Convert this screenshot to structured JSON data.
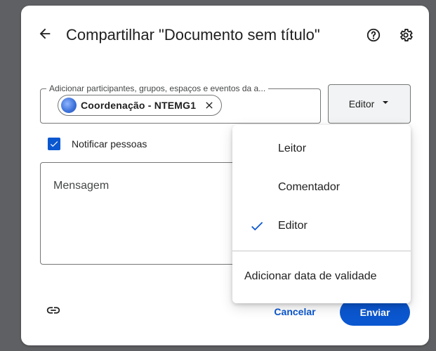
{
  "dialog": {
    "title": "Compartilhar \"Documento sem título\"",
    "share_field_label": "Adicionar participantes, grupos, espaços e eventos da a...",
    "chip_label": "Coordenação - NTEMG1",
    "role_selected": "Editor",
    "notify_label": "Notificar pessoas",
    "notify_checked": true,
    "message_placeholder": "Mensagem",
    "cancel_label": "Cancelar",
    "send_label": "Enviar"
  },
  "role_menu": {
    "items": [
      {
        "label": "Leitor",
        "selected": false
      },
      {
        "label": "Comentador",
        "selected": false
      },
      {
        "label": "Editor",
        "selected": true
      }
    ],
    "expiry_label": "Adicionar data de validade"
  },
  "icons": {
    "back": "arrow-back-icon",
    "help": "help-icon",
    "settings": "gear-icon",
    "chip_remove": "close-icon",
    "dropdown": "dropdown-arrow-icon",
    "check": "check-icon",
    "link": "link-icon"
  },
  "colors": {
    "accent": "#0b57d0",
    "backdrop": "#5f6063"
  }
}
